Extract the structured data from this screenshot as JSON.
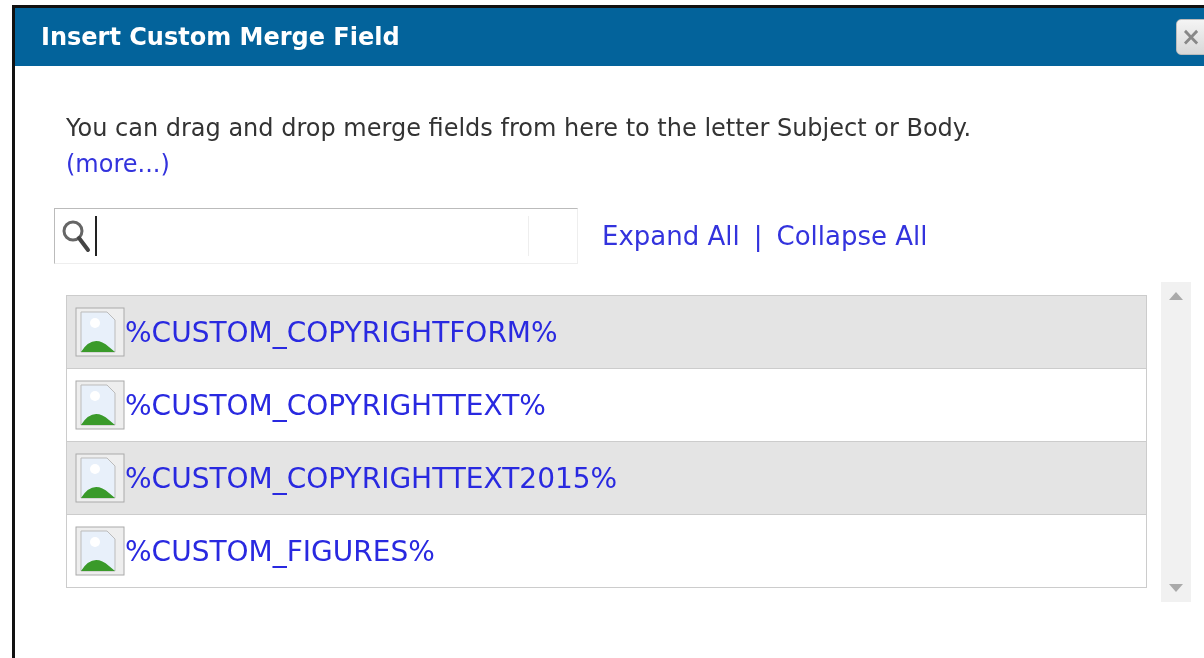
{
  "window": {
    "title": "Insert Custom Merge Field",
    "close_label": "×"
  },
  "intro": {
    "text": "You can drag and drop merge fields from here to the letter Subject or Body.",
    "link": "(more...)"
  },
  "toolbar": {
    "expand": "Expand All",
    "separator": "|",
    "collapse": "Collapse All"
  },
  "fields": [
    {
      "label": "%CUSTOM_COPYRIGHTFORM%"
    },
    {
      "label": "%CUSTOM_COPYRIGHTTEXT%"
    },
    {
      "label": "%CUSTOM_COPYRIGHTTEXT2015%"
    },
    {
      "label": "%CUSTOM_FIGURES%"
    }
  ]
}
